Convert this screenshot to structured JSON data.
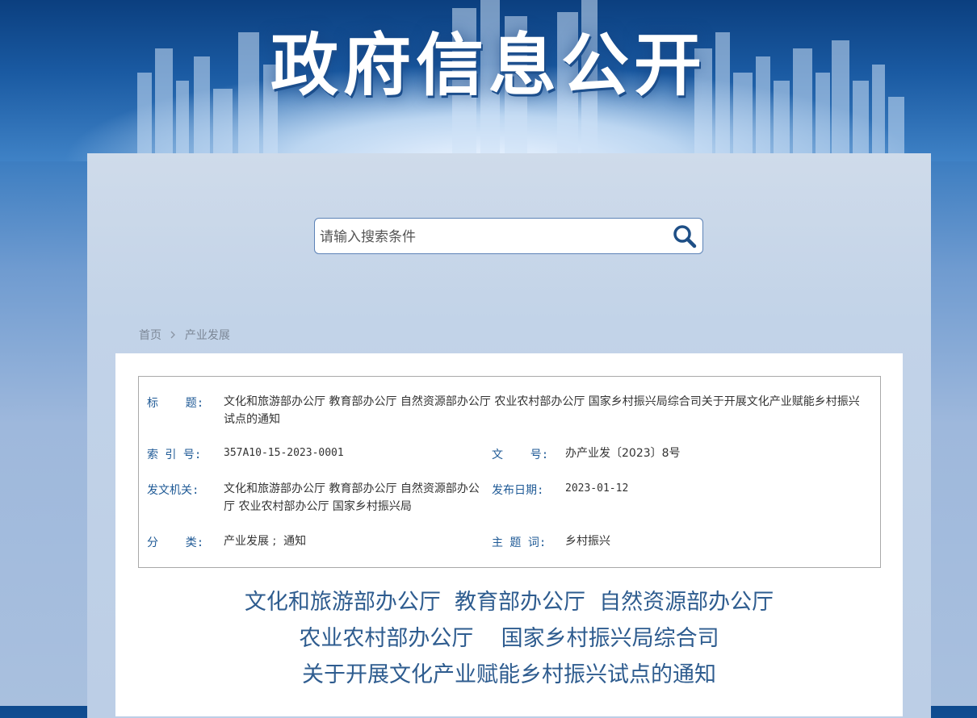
{
  "banner": {
    "title": "政府信息公开"
  },
  "search": {
    "placeholder": "请输入搜索条件"
  },
  "breadcrumb": {
    "home": "首页",
    "current": "产业发展"
  },
  "meta": {
    "title_label": "标    题:",
    "title_value": "文化和旅游部办公厅 教育部办公厅 自然资源部办公厅 农业农村部办公厅  国家乡村振兴局综合司关于开展文化产业赋能乡村振兴试点的通知",
    "index_label": "索 引 号:",
    "index_value": "357A10-15-2023-0001",
    "docno_label": "文    号:",
    "docno_value": "办产业发〔2023〕8号",
    "issuer_label": "发文机关:",
    "issuer_value": "文化和旅游部办公厅 教育部办公厅 自然资源部办公厅 农业农村部办公厅 国家乡村振兴局",
    "date_label": "发布日期:",
    "date_value": "2023-01-12",
    "category_label": "分    类:",
    "category_value": "产业发展 ;  通知",
    "keyword_label": "主 题 词:",
    "keyword_value": "乡村振兴"
  },
  "document": {
    "title_line1": "文化和旅游部办公厅  教育部办公厅  自然资源部办公厅",
    "title_line2": "农业农村部办公厅    国家乡村振兴局综合司",
    "title_line3": "关于开展文化产业赋能乡村振兴试点的通知"
  },
  "colors": {
    "accent": "#1f5a96",
    "title": "#2e5c8f",
    "border": "#a9a9a9"
  },
  "icons": {
    "search": "search-icon",
    "breadcrumb_separator": "chevron-right-icon"
  }
}
